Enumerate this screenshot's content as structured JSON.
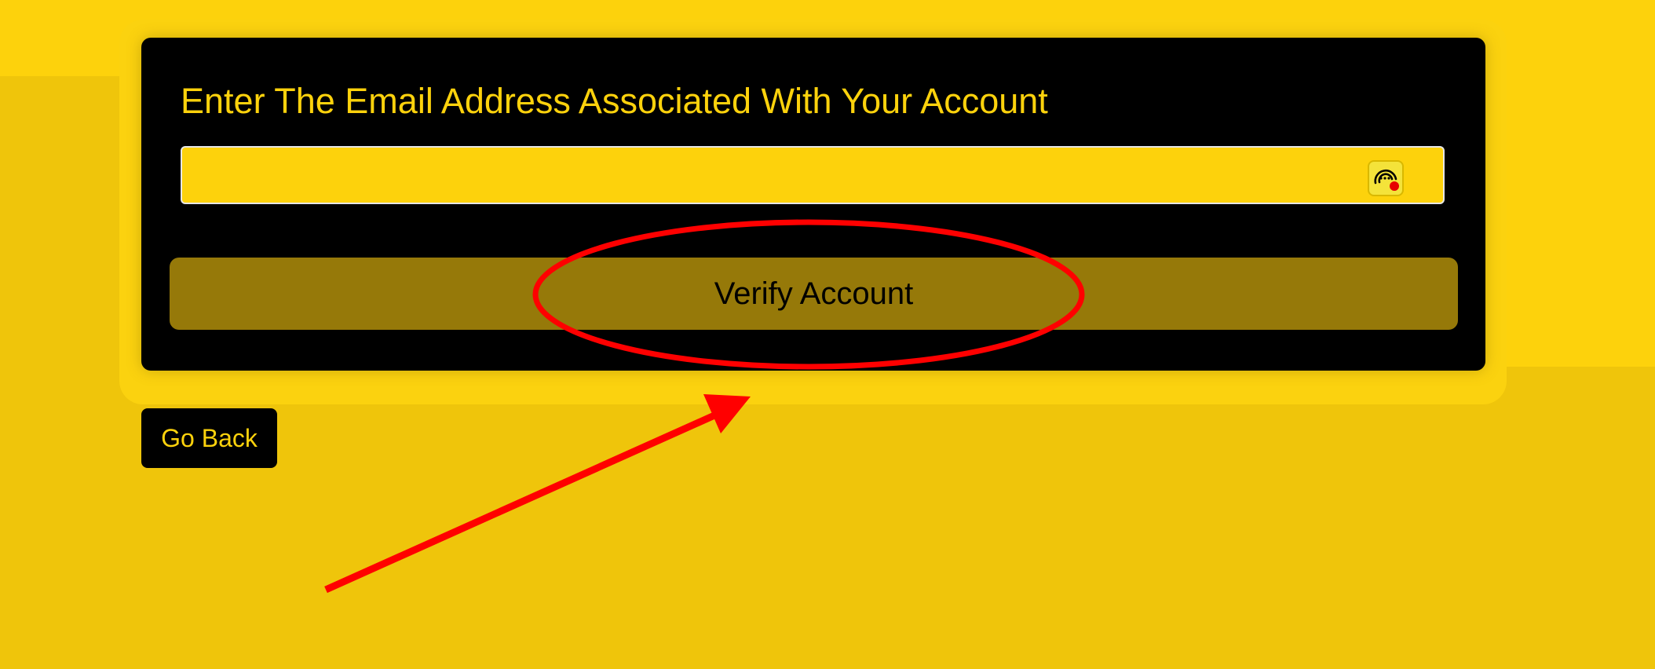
{
  "form": {
    "title": "Enter The Email Address Associated With Your Account",
    "email_value": "",
    "verify_label": "Verify Account"
  },
  "nav": {
    "back_label": "Go Back"
  },
  "extension_icon": {
    "name": "password-manager-icon"
  },
  "colors": {
    "background": "#efc50b",
    "accent_yellow": "#fdd20c",
    "card": "#000000",
    "verify_button": "#967909",
    "annotation_red": "#ff0000"
  }
}
